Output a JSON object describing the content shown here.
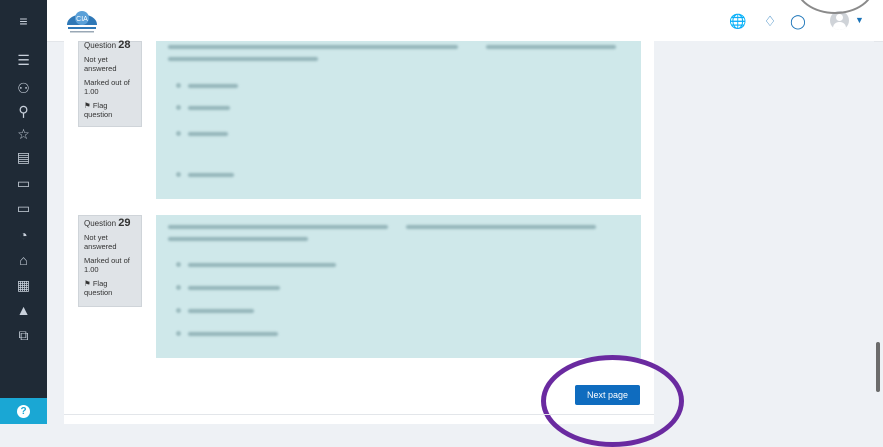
{
  "sidebar": {
    "icons": [
      "menu-icon",
      "list-icon",
      "users-icon",
      "badge-icon",
      "star-icon",
      "book-icon",
      "folder-icon",
      "folder-icon",
      "dashboard-icon",
      "home-icon",
      "calendar-icon",
      "graduation-cap-icon",
      "copy-icon"
    ],
    "help_label": "?"
  },
  "navbar": {
    "logo_text": "CIA",
    "icons": [
      "globe-icon",
      "bell-icon",
      "chat-icon"
    ]
  },
  "questions": [
    {
      "number_prefix": "Question",
      "number": "28",
      "status": "Not yet answered",
      "marks": "Marked out of 1.00",
      "flag": "Flag question",
      "flag_icon": "flag-icon"
    },
    {
      "number_prefix": "Question",
      "number": "29",
      "status": "Not yet answered",
      "marks": "Marked out of 1.00",
      "flag": "Flag question",
      "flag_icon": "flag-icon"
    }
  ],
  "next_page_label": "Next page",
  "colors": {
    "sidebar": "#1f2a36",
    "accent": "#0f6cbf",
    "panel": "#cfe8ea",
    "annotation_ring": "#6a2aa0"
  }
}
